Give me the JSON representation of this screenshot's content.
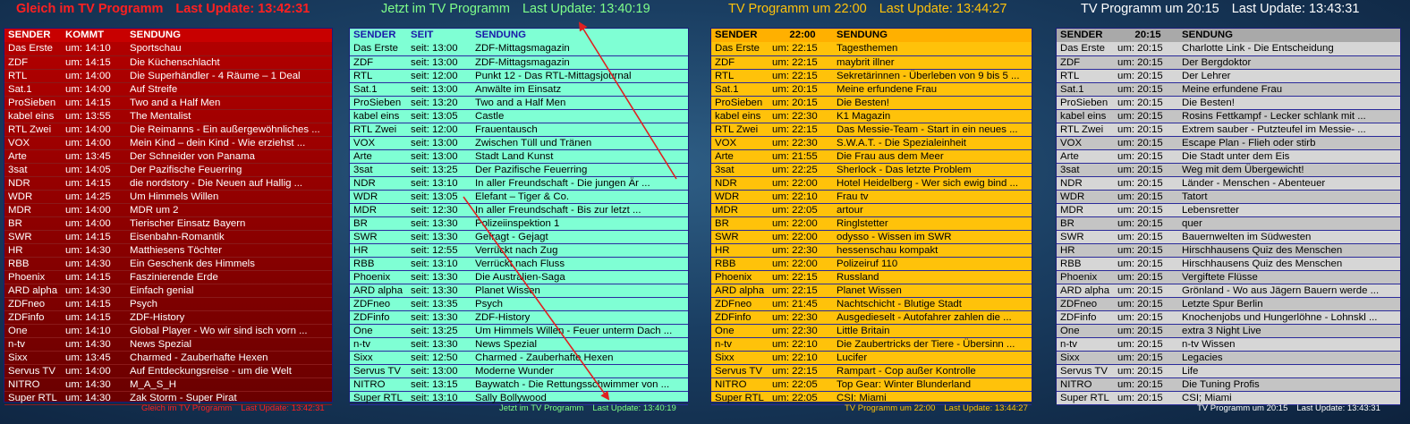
{
  "panels": [
    {
      "header": {
        "title": "Gleich im TV Programm",
        "update": "Last Update: 13:42:31"
      },
      "columns": [
        "SENDER",
        "KOMMT",
        "SENDUNG"
      ],
      "rows": [
        [
          "Das Erste",
          "um: 14:10",
          "Sportschau"
        ],
        [
          "ZDF",
          "um: 14:15",
          "Die Küchenschlacht"
        ],
        [
          "RTL",
          "um: 14:00",
          "Die Superhändler - 4 Räume – 1 Deal"
        ],
        [
          "Sat.1",
          "um: 14:00",
          "Auf Streife"
        ],
        [
          "ProSieben",
          "um: 14:15",
          "Two and a Half Men"
        ],
        [
          "kabel eins",
          "um: 13:55",
          "The Mentalist"
        ],
        [
          "RTL Zwei",
          "um: 14:00",
          "Die Reimanns - Ein außergewöhnliches ..."
        ],
        [
          "VOX",
          "um: 14:00",
          "Mein Kind – dein Kind - Wie erziehst ..."
        ],
        [
          "Arte",
          "um: 13:45",
          "Der Schneider von Panama"
        ],
        [
          "3sat",
          "um: 14:05",
          "Der Pazifische Feuerring"
        ],
        [
          "NDR",
          "um: 14:15",
          "die nordstory - Die Neuen auf Hallig ..."
        ],
        [
          "WDR",
          "um: 14:25",
          "Um Himmels Willen"
        ],
        [
          "MDR",
          "um: 14:00",
          "MDR um 2"
        ],
        [
          "BR",
          "um: 14:00",
          "Tierischer Einsatz Bayern"
        ],
        [
          "SWR",
          "um: 14:15",
          "Eisenbahn-Romantik"
        ],
        [
          "HR",
          "um: 14:30",
          "Matthiesens Töchter"
        ],
        [
          "RBB",
          "um: 14:30",
          "Ein Geschenk des Himmels"
        ],
        [
          "Phoenix",
          "um: 14:15",
          "Faszinierende Erde"
        ],
        [
          "ARD alpha",
          "um: 14:30",
          "Einfach genial"
        ],
        [
          "ZDFneo",
          "um: 14:15",
          "Psych"
        ],
        [
          "ZDFinfo",
          "um: 14:15",
          "ZDF-History"
        ],
        [
          "One",
          "um: 14:10",
          "Global Player - Wo wir sind isch vorn ..."
        ],
        [
          "n-tv",
          "um: 14:30",
          "News Spezial"
        ],
        [
          "Sixx",
          "um: 13:45",
          "Charmed - Zauberhafte Hexen"
        ],
        [
          "Servus TV",
          "um: 14:00",
          "Auf Entdeckungsreise - um die Welt"
        ],
        [
          "NITRO",
          "um: 14:30",
          "M_A_S_H"
        ],
        [
          "Super RTL",
          "um: 14:30",
          "Zak Storm - Super Pirat"
        ]
      ]
    },
    {
      "header": {
        "title": "Jetzt im TV Programm",
        "update": "Last Update: 13:40:19"
      },
      "columns": [
        "SENDER",
        "SEIT",
        "SENDUNG"
      ],
      "rows": [
        [
          "Das Erste",
          "seit: 13:00",
          "ZDF-Mittagsmagazin"
        ],
        [
          "ZDF",
          "seit: 13:00",
          "ZDF-Mittagsmagazin"
        ],
        [
          "RTL",
          "seit: 12:00",
          "Punkt 12 - Das RTL-Mittagsjournal"
        ],
        [
          "Sat.1",
          "seit: 13:00",
          "Anwälte im Einsatz"
        ],
        [
          "ProSieben",
          "seit: 13:20",
          "Two and a Half Men"
        ],
        [
          "kabel eins",
          "seit: 13:05",
          "Castle"
        ],
        [
          "RTL Zwei",
          "seit: 12:00",
          "Frauentausch"
        ],
        [
          "VOX",
          "seit: 13:00",
          "Zwischen Tüll und Tränen"
        ],
        [
          "Arte",
          "seit: 13:00",
          "Stadt Land Kunst"
        ],
        [
          "3sat",
          "seit: 13:25",
          "Der Pazifische Feuerring"
        ],
        [
          "NDR",
          "seit: 13:10",
          "In aller Freundschaft - Die jungen Är ..."
        ],
        [
          "WDR",
          "seit: 13:05",
          "Elefant – Tiger & Co."
        ],
        [
          "MDR",
          "seit: 12:30",
          "In aller Freundschaft - Bis zur letzt ..."
        ],
        [
          "BR",
          "seit: 13:30",
          "Polizeiinspektion 1"
        ],
        [
          "SWR",
          "seit: 13:30",
          "Gefragt - Gejagt"
        ],
        [
          "HR",
          "seit: 12:55",
          "Verrückt nach Zug"
        ],
        [
          "RBB",
          "seit: 13:10",
          "Verrückt nach Fluss"
        ],
        [
          "Phoenix",
          "seit: 13:30",
          "Die Australien-Saga"
        ],
        [
          "ARD alpha",
          "seit: 13:30",
          "Planet Wissen"
        ],
        [
          "ZDFneo",
          "seit: 13:35",
          "Psych"
        ],
        [
          "ZDFinfo",
          "seit: 13:30",
          "ZDF-History"
        ],
        [
          "One",
          "seit: 13:25",
          "Um Himmels Willen - Feuer unterm Dach ..."
        ],
        [
          "n-tv",
          "seit: 13:30",
          "News Spezial"
        ],
        [
          "Sixx",
          "seit: 12:50",
          "Charmed - Zauberhafte Hexen"
        ],
        [
          "Servus TV",
          "seit: 13:00",
          "Moderne Wunder"
        ],
        [
          "NITRO",
          "seit: 13:15",
          "Baywatch - Die Rettungsschwimmer von ..."
        ],
        [
          "Super RTL",
          "seit: 13:10",
          "Sally Bollywood"
        ]
      ]
    },
    {
      "header": {
        "title": "TV Programm um 22:00",
        "update": "Last Update: 13:44:27"
      },
      "columns": [
        "SENDER",
        "22:00",
        "SENDUNG"
      ],
      "rows": [
        [
          "Das Erste",
          "um: 22:15",
          "Tagesthemen"
        ],
        [
          "ZDF",
          "um: 22:15",
          "maybrit illner"
        ],
        [
          "RTL",
          "um: 22:15",
          "Sekretärinnen - Überleben von 9 bis 5 ..."
        ],
        [
          "Sat.1",
          "um: 20:15",
          "Meine erfundene Frau"
        ],
        [
          "ProSieben",
          "um: 20:15",
          "Die Besten!"
        ],
        [
          "kabel eins",
          "um: 22:30",
          "K1 Magazin"
        ],
        [
          "RTL Zwei",
          "um: 22:15",
          "Das Messie-Team - Start in ein neues ..."
        ],
        [
          "VOX",
          "um: 22:30",
          "S.W.A.T. - Die Spezialeinheit"
        ],
        [
          "Arte",
          "um: 21:55",
          "Die Frau aus dem Meer"
        ],
        [
          "3sat",
          "um: 22:25",
          "Sherlock - Das letzte Problem"
        ],
        [
          "NDR",
          "um: 22:00",
          "Hotel Heidelberg - Wer sich ewig bind ..."
        ],
        [
          "WDR",
          "um: 22:10",
          "Frau tv"
        ],
        [
          "MDR",
          "um: 22:05",
          "artour"
        ],
        [
          "BR",
          "um: 22:00",
          "Ringlstetter"
        ],
        [
          "SWR",
          "um: 22:00",
          "odysso - Wissen im SWR"
        ],
        [
          "HR",
          "um: 22:30",
          "hessenschau kompakt"
        ],
        [
          "RBB",
          "um: 22:00",
          "Polizeiruf 110"
        ],
        [
          "Phoenix",
          "um: 22:15",
          "Russland"
        ],
        [
          "ARD alpha",
          "um: 22:15",
          "Planet Wissen"
        ],
        [
          "ZDFneo",
          "um: 21:45",
          "Nachtschicht - Blutige Stadt"
        ],
        [
          "ZDFinfo",
          "um: 22:30",
          "Ausgedieselt - Autofahrer zahlen die ..."
        ],
        [
          "One",
          "um: 22:30",
          "Little Britain"
        ],
        [
          "n-tv",
          "um: 22:10",
          "Die Zaubertricks der Tiere - Übersinn ..."
        ],
        [
          "Sixx",
          "um: 22:10",
          "Lucifer"
        ],
        [
          "Servus TV",
          "um: 22:15",
          "Rampart - Cop außer Kontrolle"
        ],
        [
          "NITRO",
          "um: 22:05",
          "Top Gear: Winter Blunderland"
        ],
        [
          "Super RTL",
          "um: 22:05",
          "CSI: Miami"
        ]
      ]
    },
    {
      "header": {
        "title": "TV Programm um 20:15",
        "update": "Last Update: 13:43:31"
      },
      "columns": [
        "SENDER",
        "20:15",
        "SENDUNG"
      ],
      "rows": [
        [
          "Das Erste",
          "um: 20:15",
          "Charlotte Link - Die Entscheidung"
        ],
        [
          "ZDF",
          "um: 20:15",
          "Der Bergdoktor"
        ],
        [
          "RTL",
          "um: 20:15",
          "Der Lehrer"
        ],
        [
          "Sat.1",
          "um: 20:15",
          "Meine erfundene Frau"
        ],
        [
          "ProSieben",
          "um: 20:15",
          "Die Besten!"
        ],
        [
          "kabel eins",
          "um: 20:15",
          "Rosins Fettkampf - Lecker schlank mit ..."
        ],
        [
          "RTL Zwei",
          "um: 20:15",
          "Extrem sauber - Putzteufel im Messie- ..."
        ],
        [
          "VOX",
          "um: 20:15",
          "Escape Plan - Flieh oder stirb"
        ],
        [
          "Arte",
          "um: 20:15",
          "Die Stadt unter dem Eis"
        ],
        [
          "3sat",
          "um: 20:15",
          "Weg mit dem Übergewicht!"
        ],
        [
          "NDR",
          "um: 20:15",
          "Länder - Menschen - Abenteuer"
        ],
        [
          "WDR",
          "um: 20:15",
          "Tatort"
        ],
        [
          "MDR",
          "um: 20:15",
          "Lebensretter"
        ],
        [
          "BR",
          "um: 20:15",
          "quer"
        ],
        [
          "SWR",
          "um: 20:15",
          "Bauernwelten im Südwesten"
        ],
        [
          "HR",
          "um: 20:15",
          "Hirschhausens Quiz des Menschen"
        ],
        [
          "RBB",
          "um: 20:15",
          "Hirschhausens Quiz des Menschen"
        ],
        [
          "Phoenix",
          "um: 20:15",
          "Vergiftete Flüsse"
        ],
        [
          "ARD alpha",
          "um: 20:15",
          "Grönland - Wo aus Jägern Bauern werde ..."
        ],
        [
          "ZDFneo",
          "um: 20:15",
          "Letzte Spur Berlin"
        ],
        [
          "ZDFinfo",
          "um: 20:15",
          "Knochenjobs und Hungerlöhne - Lohnskl ..."
        ],
        [
          "One",
          "um: 20:15",
          "extra 3 Night Live"
        ],
        [
          "n-tv",
          "um: 20:15",
          "n-tv Wissen"
        ],
        [
          "Sixx",
          "um: 20:15",
          "Legacies"
        ],
        [
          "Servus TV",
          "um: 20:15",
          "Life"
        ],
        [
          "NITRO",
          "um: 20:15",
          "Die Tuning Profis"
        ],
        [
          "Super RTL",
          "um: 20:15",
          "CSI; Miami"
        ]
      ]
    }
  ],
  "colors": {
    "panel1_header": "#ff2020",
    "panel2_header": "#7fff8a",
    "panel3_header": "#ffc20a",
    "panel4_header": "#ffffff",
    "arrow": "#e02020"
  }
}
